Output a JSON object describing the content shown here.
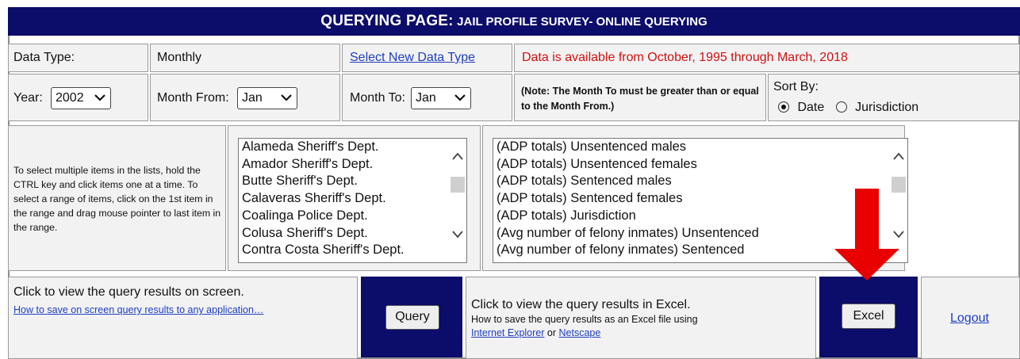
{
  "banner": {
    "title_main": "QUERYING PAGE:",
    "title_sub": "JAIL PROFILE SURVEY- ONLINE QUERYING"
  },
  "row1": {
    "data_type_label": "Data Type:",
    "data_type_value": "Monthly",
    "select_new_link": "Select New Data Type",
    "availability": "Data is available from October, 1995 through March, 2018"
  },
  "row2": {
    "year_label": "Year:",
    "year_value": "2002",
    "month_from_label": "Month From:",
    "month_from_value": "Jan",
    "month_to_label": "Month To:",
    "month_to_value": "Jan",
    "note": "(Note: The Month To must be greater than or equal to the Month From.)",
    "sort_by_label": "Sort By:",
    "sort_options": [
      {
        "label": "Date",
        "selected": true
      },
      {
        "label": "Jurisdiction",
        "selected": false
      }
    ]
  },
  "instructions": "To select multiple items in the lists, hold the CTRL key and click items one at a time. To select a range of items, click on the 1st item in the range and drag mouse pointer to last item in the range.",
  "jurisdictions": [
    "Alameda Sheriff's Dept.",
    "Amador Sheriff's Dept.",
    "Butte Sheriff's Dept.",
    "Calaveras Sheriff's Dept.",
    "Coalinga Police Dept.",
    "Colusa Sheriff's Dept.",
    "Contra Costa Sheriff's Dept."
  ],
  "measures": [
    "(ADP totals) Unsentenced males",
    "(ADP totals) Unsentenced females",
    "(ADP totals) Sentenced males",
    "(ADP totals) Sentenced females",
    "(ADP totals) Jurisdiction",
    "(Avg number of felony inmates) Unsentenced",
    "(Avg number of felony inmates) Sentenced"
  ],
  "bottom": {
    "screen_text": "Click to view the query results on screen.",
    "screen_help_link": "How to save on screen query results to any application…",
    "query_button": "Query",
    "excel_text": "Click to view the query results in Excel.",
    "excel_help_text": "How to save the query results as an Excel file using",
    "ie_link": "Internet Explorer",
    "or_text": "or",
    "netscape_link": "Netscape",
    "excel_button": "Excel",
    "logout_link": "Logout"
  },
  "colors": {
    "banner": "#0c0c6b",
    "availability": "#d01010",
    "link": "#1f3fc0",
    "arrow": "#e80000"
  },
  "icons": {
    "dropdown": "chevron-down-icon",
    "scroll_up": "chevron-up-icon",
    "scroll_down": "chevron-down-icon",
    "annotation": "red-arrow-down-icon"
  }
}
